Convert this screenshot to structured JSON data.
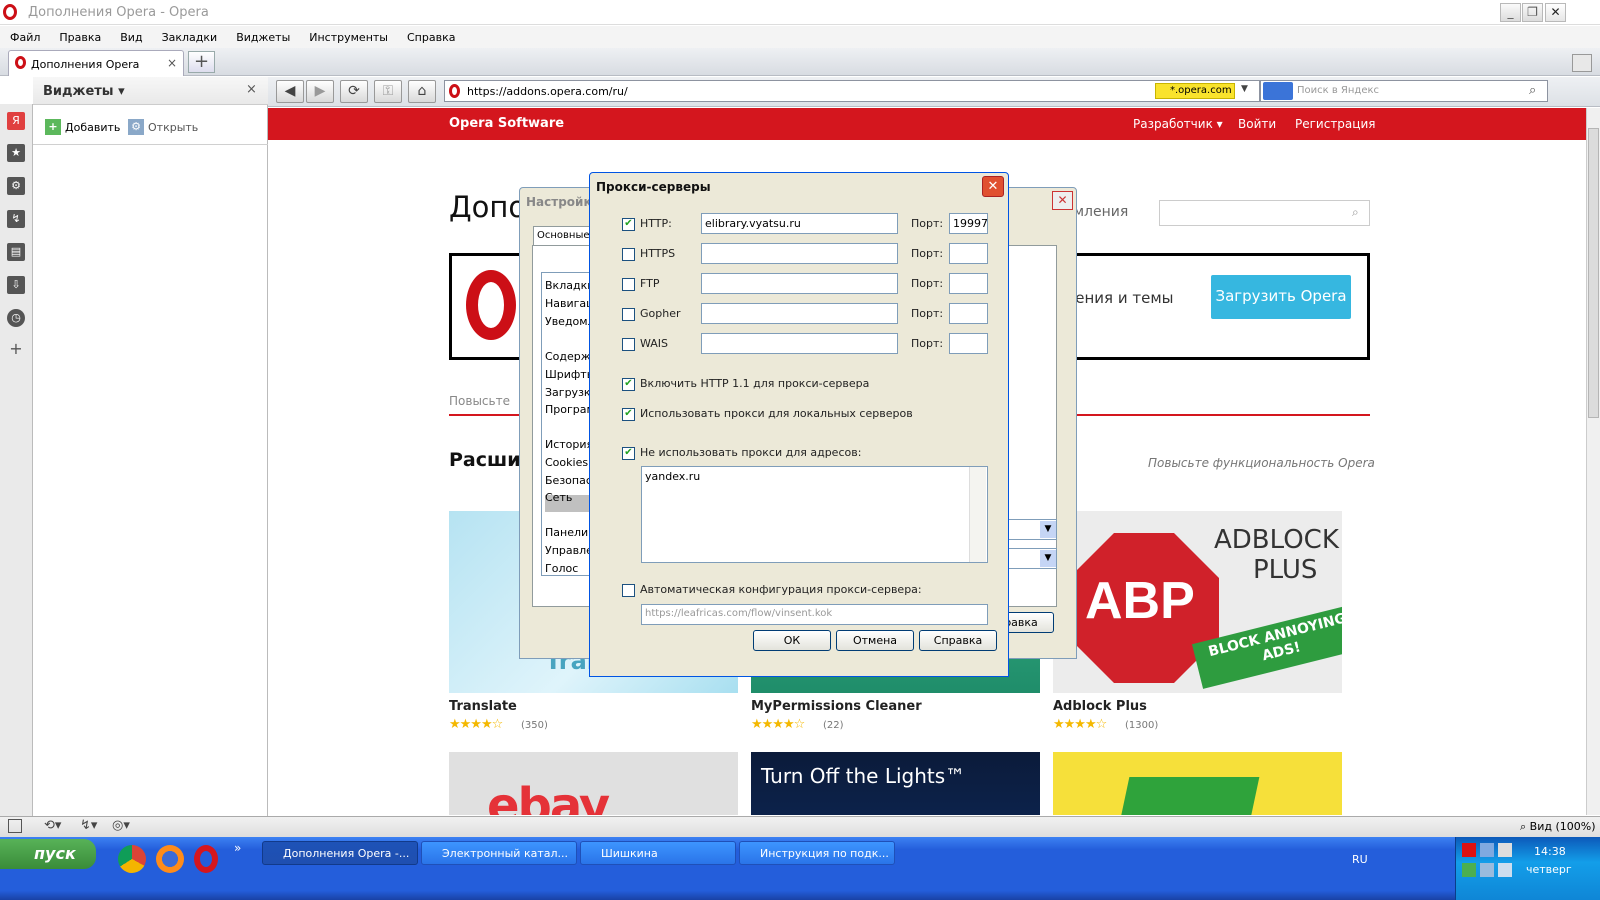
{
  "window": {
    "title": "Дополнения Opera - Opera"
  },
  "menu": [
    "Файл",
    "Правка",
    "Вид",
    "Закладки",
    "Виджеты",
    "Инструменты",
    "Справка"
  ],
  "tab": {
    "label": "Дополнения Opera",
    "close": "×"
  },
  "panel": {
    "title": "Виджеты",
    "close": "×",
    "add_label": "Добавить",
    "open_label": "Открыть"
  },
  "address": {
    "url": "https://addons.opera.com/ru/",
    "security_badge": "*.opera.com",
    "search_placeholder": "Поиск в Яндекс"
  },
  "page": {
    "brand": "Opera Software",
    "nav": [
      "Разработчик ▾",
      "Войти",
      "Регистрация"
    ],
    "title": "Допо",
    "title_tail": "ормления",
    "banner_text": "ирения и темы",
    "download_button": "Загрузить Opera",
    "promo_tab": "Повысьте",
    "section_title": "Расши",
    "section_subtitle": "Повысьте функциональность Opera",
    "cards": [
      {
        "name": "Translate",
        "stars": "★★★★☆",
        "count": "(350)",
        "overlay": "Translate"
      },
      {
        "name": "MyPermissions Cleaner",
        "stars": "★★★★☆",
        "count": "(22)"
      },
      {
        "name": "Adblock Plus",
        "stars": "★★★★☆",
        "count": "(1300)",
        "overlay1": "ADBLOCK",
        "overlay2": "PLUS",
        "overlay3": "ABP",
        "overlay4": "BLOCK ANNOYING ADS!"
      }
    ],
    "bottom_cards": [
      {
        "text": "ebay"
      },
      {
        "text": "Turn Off the Lights™"
      },
      {
        "text": ""
      }
    ]
  },
  "settings_dialog": {
    "title": "Настройки",
    "tab": "Основные",
    "list": [
      "Вкладки",
      "Навигация",
      "Уведомления",
      "Содержимое",
      "Шрифты",
      "Загрузки",
      "Программы",
      "История",
      "Cookies",
      "Безопасность",
      "Сеть",
      "Панели",
      "Управление",
      "Голос"
    ],
    "selected": "Сеть",
    "help_button": "правка"
  },
  "proxy_dialog": {
    "title": "Прокси-серверы",
    "port_label": "Порт:",
    "rows": [
      {
        "label": "HTTP:",
        "checked": true,
        "host": "elibrary.vyatsu.ru",
        "port": "19997"
      },
      {
        "label": "HTTPS",
        "checked": false,
        "host": "",
        "port": ""
      },
      {
        "label": "FTP",
        "checked": false,
        "host": "",
        "port": ""
      },
      {
        "label": "Gopher",
        "checked": false,
        "host": "",
        "port": ""
      },
      {
        "label": "WAIS",
        "checked": false,
        "host": "",
        "port": ""
      }
    ],
    "http11": "Включить HTTP 1.1 для прокси-сервера",
    "local": "Использовать прокси для локальных серверов",
    "exclude": "Не использовать прокси для адресов:",
    "exclude_list": "yandex.ru",
    "autoconfig": "Автоматическая конфигурация прокси-сервера:",
    "autoconfig_url": "https://leafricas.com/flow/vinsent.kok",
    "ok": "ОК",
    "cancel": "Отмена",
    "help": "Справка"
  },
  "statusbar": {
    "zoom": "Вид (100%)"
  },
  "taskbar": {
    "start": "пуск",
    "tasks": [
      "Дополнения Opera -...",
      "Электронный катал...",
      "Шишкина",
      "Инструкция по подк..."
    ],
    "lang": "RU",
    "time": "14:38",
    "day": "четверг"
  },
  "colors": {
    "opera_red": "#d4161e",
    "download_blue": "#36b7e0",
    "xp_blue": "#245edb",
    "start_green": "#3a8c3a"
  }
}
